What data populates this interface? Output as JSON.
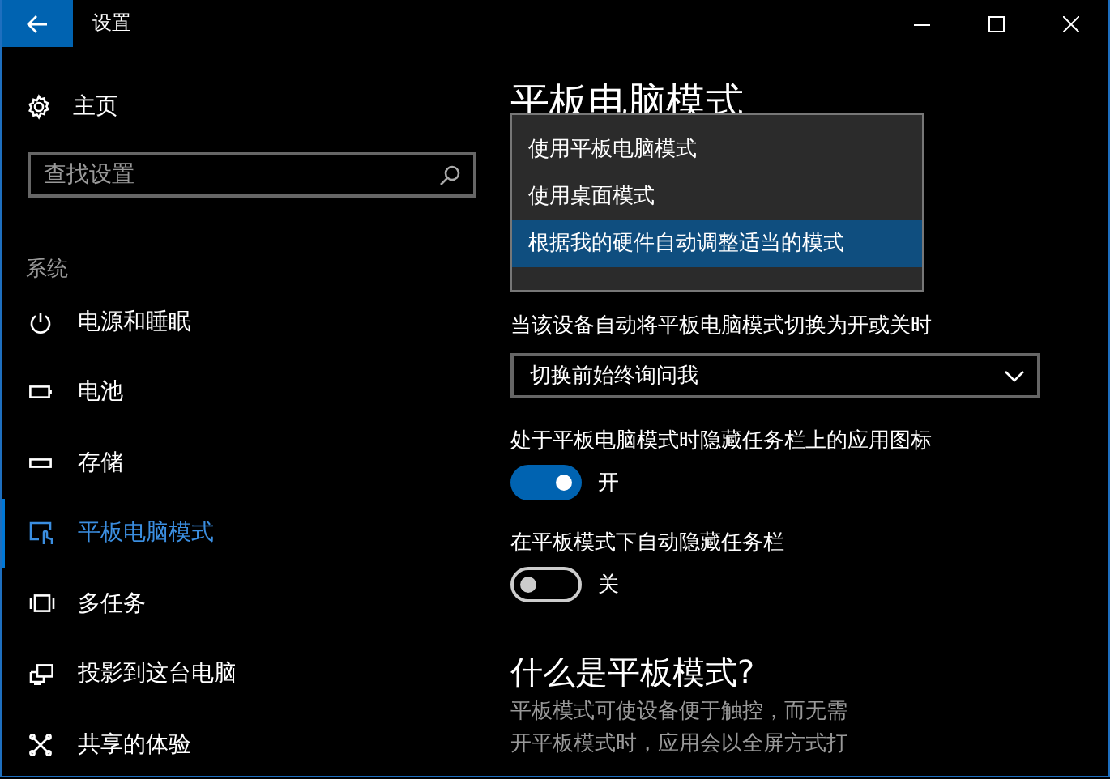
{
  "window": {
    "title": "设置"
  },
  "sidebar": {
    "home": "主页",
    "search": {
      "placeholder": "查找设置"
    },
    "section": "系统",
    "items": [
      {
        "label": "电源和睡眠",
        "selected": false
      },
      {
        "label": "电池",
        "selected": false
      },
      {
        "label": "存储",
        "selected": false
      },
      {
        "label": "平板电脑模式",
        "selected": true
      },
      {
        "label": "多任务",
        "selected": false
      },
      {
        "label": "投影到这台电脑",
        "selected": false
      },
      {
        "label": "共享的体验",
        "selected": false
      }
    ]
  },
  "content": {
    "title": "平板电脑模式",
    "mode_menu": {
      "options": [
        {
          "label": "使用平板电脑模式",
          "selected": false
        },
        {
          "label": "使用桌面模式",
          "selected": false
        },
        {
          "label": "根据我的硬件自动调整适当的模式",
          "selected": true
        }
      ]
    },
    "switch_prompt": {
      "label": "当该设备自动将平板电脑模式切换为开或关时",
      "value": "切换前始终询问我"
    },
    "toggles": [
      {
        "label": "处于平板电脑模式时隐藏任务栏上的应用图标",
        "on": true,
        "state": "开"
      },
      {
        "label": "在平板模式下自动隐藏任务栏",
        "on": false,
        "state": "关"
      }
    ],
    "about": {
      "heading": "什么是平板模式?",
      "lines": [
        "平板模式可使设备便于触控，而无需",
        "开平板模式时，应用会以全屏方式打"
      ]
    }
  }
}
